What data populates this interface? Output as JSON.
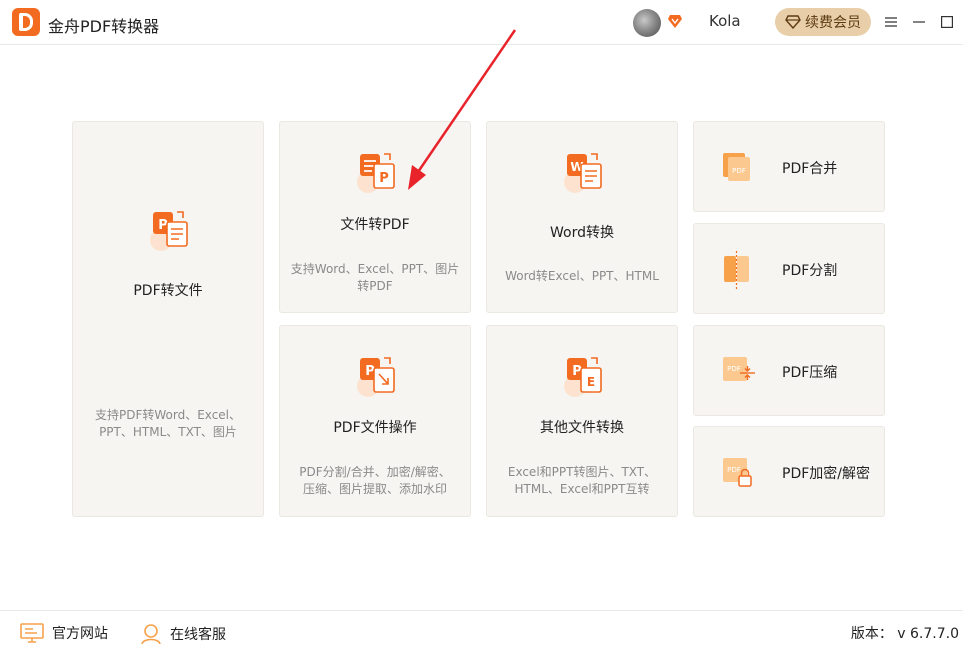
{
  "app": {
    "title": "金舟PDF转换器"
  },
  "header": {
    "username": "Kola",
    "renew_label": "续费会员"
  },
  "cards": {
    "pdf_to_file": {
      "title": "PDF转文件",
      "desc": "支持PDF转Word、Excel、PPT、HTML、TXT、图片"
    },
    "file_to_pdf": {
      "title": "文件转PDF",
      "desc": "支持Word、Excel、PPT、图片转PDF"
    },
    "word_convert": {
      "title": "Word转换",
      "desc": "Word转Excel、PPT、HTML"
    },
    "pdf_ops": {
      "title": "PDF文件操作",
      "desc": "PDF分割/合并、加密/解密、压缩、图片提取、添加水印"
    },
    "other_convert": {
      "title": "其他文件转换",
      "desc": "Excel和PPT转图片、TXT、HTML、Excel和PPT互转"
    }
  },
  "tools": {
    "merge": "PDF合并",
    "split": "PDF分割",
    "compress": "PDF压缩",
    "encrypt": "PDF加密/解密",
    "icon_text": "PDF"
  },
  "icon_letters": {
    "p": "P",
    "w": "W",
    "e": "E"
  },
  "footer": {
    "website": "官方网站",
    "support": "在线客服",
    "version": "版本： v 6.7.7.0"
  },
  "colors": {
    "accent": "#f26b21",
    "annotation_arrow": "#e8232a",
    "card_bg": "#f6f5f2",
    "gold": "#e8cfa9"
  }
}
